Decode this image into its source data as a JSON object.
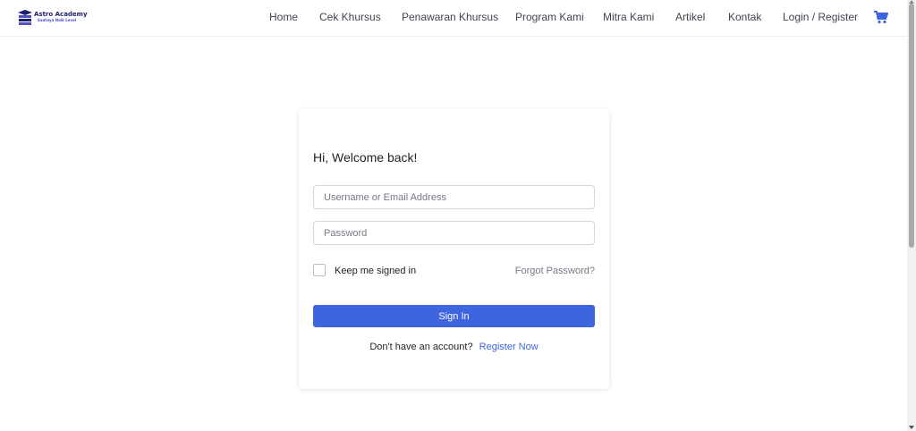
{
  "brand": {
    "name": "Astro Academy",
    "tagline": "Saatnya Naik Level",
    "colors": {
      "primary": "#3e64de",
      "logo_dark": "#1d1f6b",
      "logo_accent": "#4b52c5"
    }
  },
  "nav": {
    "items": [
      {
        "label": "Home"
      },
      {
        "label": "Cek Khursus"
      },
      {
        "label": "Penawaran Khursus"
      },
      {
        "label": "Program Kami"
      },
      {
        "label": "Mitra Kami"
      },
      {
        "label": "Artikel"
      },
      {
        "label": "Kontak"
      },
      {
        "label": "Login / Register"
      }
    ],
    "cart_icon": "shopping-cart-icon"
  },
  "login": {
    "heading": "Hi, Welcome back!",
    "username_placeholder": "Username or Email Address",
    "password_placeholder": "Password",
    "remember_label": "Keep me signed in",
    "remember_checked": false,
    "forgot_label": "Forgot Password?",
    "submit_label": "Sign In",
    "no_account_text": "Don't have an account?",
    "register_label": "Register Now"
  }
}
